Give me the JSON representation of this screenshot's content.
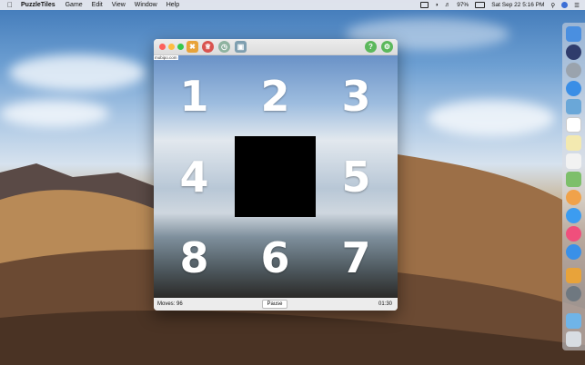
{
  "menubar": {
    "app_name": "PuzzleTiles",
    "items": [
      "Game",
      "Edit",
      "View",
      "Window",
      "Help"
    ],
    "battery": "97%",
    "clock": "Sat Sep 22  5:16 PM"
  },
  "window": {
    "site_label": "mobipo.com",
    "toolbar": {
      "shuffle_icon": "shuffle-icon",
      "trophy_icon": "trophy-icon",
      "clock_icon": "clock-icon",
      "save_icon": "save-icon",
      "help_label": "?",
      "settings_icon": "gear-icon"
    },
    "tiles": [
      "1",
      "2",
      "3",
      "4",
      "",
      "5",
      "8",
      "6",
      "7"
    ],
    "status": {
      "moves": "Moves: 96",
      "pause_label": "Pause",
      "timer": "01:30"
    }
  },
  "colors": {
    "close": "#fc605c",
    "minimize": "#fdbc40",
    "zoom": "#34c84a",
    "help_btn": "#5cb85c",
    "blank_tile": "#000000"
  }
}
